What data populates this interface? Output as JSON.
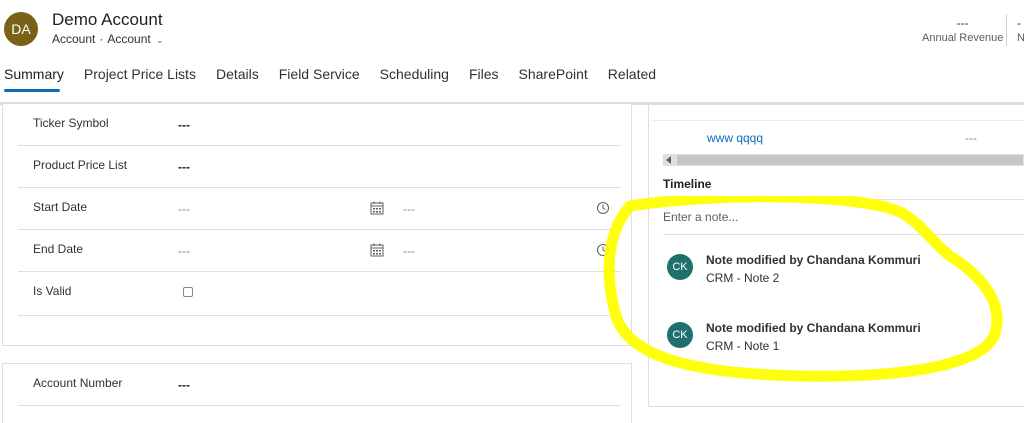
{
  "header": {
    "avatar_initials": "DA",
    "title": "Demo Account",
    "entity": "Account",
    "form": "Account",
    "kpis": [
      {
        "value": "---",
        "label": "Annual Revenue"
      },
      {
        "value": "-",
        "label": "N"
      }
    ]
  },
  "tabs": [
    {
      "label": "Summary",
      "active": true
    },
    {
      "label": "Project Price Lists"
    },
    {
      "label": "Details"
    },
    {
      "label": "Field Service"
    },
    {
      "label": "Scheduling"
    },
    {
      "label": "Files"
    },
    {
      "label": "SharePoint"
    },
    {
      "label": "Related"
    }
  ],
  "fields": {
    "ticker_symbol": {
      "label": "Ticker Symbol",
      "value": "---"
    },
    "product_price_list": {
      "label": "Product Price List",
      "value": "---"
    },
    "start_date": {
      "label": "Start Date",
      "date": "---",
      "time": "---"
    },
    "end_date": {
      "label": "End Date",
      "date": "---",
      "time": "---"
    },
    "is_valid": {
      "label": "Is Valid"
    },
    "account_number": {
      "label": "Account Number",
      "value": "---"
    }
  },
  "grid": {
    "link_text": "www qqqq",
    "value": "---"
  },
  "timeline": {
    "title": "Timeline",
    "note_placeholder": "Enter a note...",
    "notes": [
      {
        "initials": "CK",
        "title": "Note modified by Chandana Kommuri",
        "subject": "CRM - Note 2"
      },
      {
        "initials": "CK",
        "title": "Note modified by Chandana Kommuri",
        "subject": "CRM - Note 1"
      }
    ]
  },
  "colors": {
    "accent": "#0f6cbd",
    "avatar": "#7a6118",
    "note_avatar": "#1f6f6f",
    "highlight": "#ffff00"
  }
}
